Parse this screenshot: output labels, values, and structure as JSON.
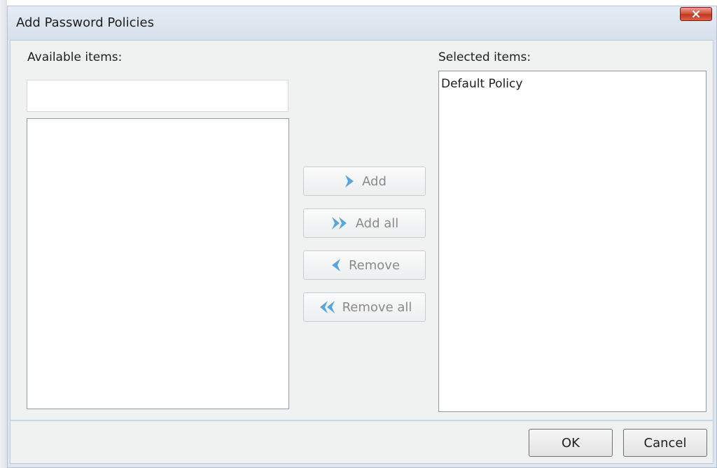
{
  "window": {
    "title": "Add Password Policies"
  },
  "available": {
    "label": "Available items:",
    "search_value": "",
    "search_placeholder": "",
    "items": []
  },
  "selected": {
    "label": "Selected items:",
    "items": [
      "Default Policy"
    ]
  },
  "transfer_buttons": {
    "add": "Add",
    "add_all": "Add all",
    "remove": "Remove",
    "remove_all": "Remove all"
  },
  "footer": {
    "ok": "OK",
    "cancel": "Cancel"
  },
  "icons": {
    "close": "close-icon",
    "add": "chevron-right-icon",
    "add_all": "double-chevron-right-icon",
    "remove": "chevron-left-icon",
    "remove_all": "double-chevron-left-icon"
  },
  "colors": {
    "title_bar": "#d6e0eb",
    "client_background": "#f0f1f1",
    "close_button": "#c0361f",
    "arrow_icon": "#5aa5dc",
    "disabled_text": "#8a8a8a"
  }
}
